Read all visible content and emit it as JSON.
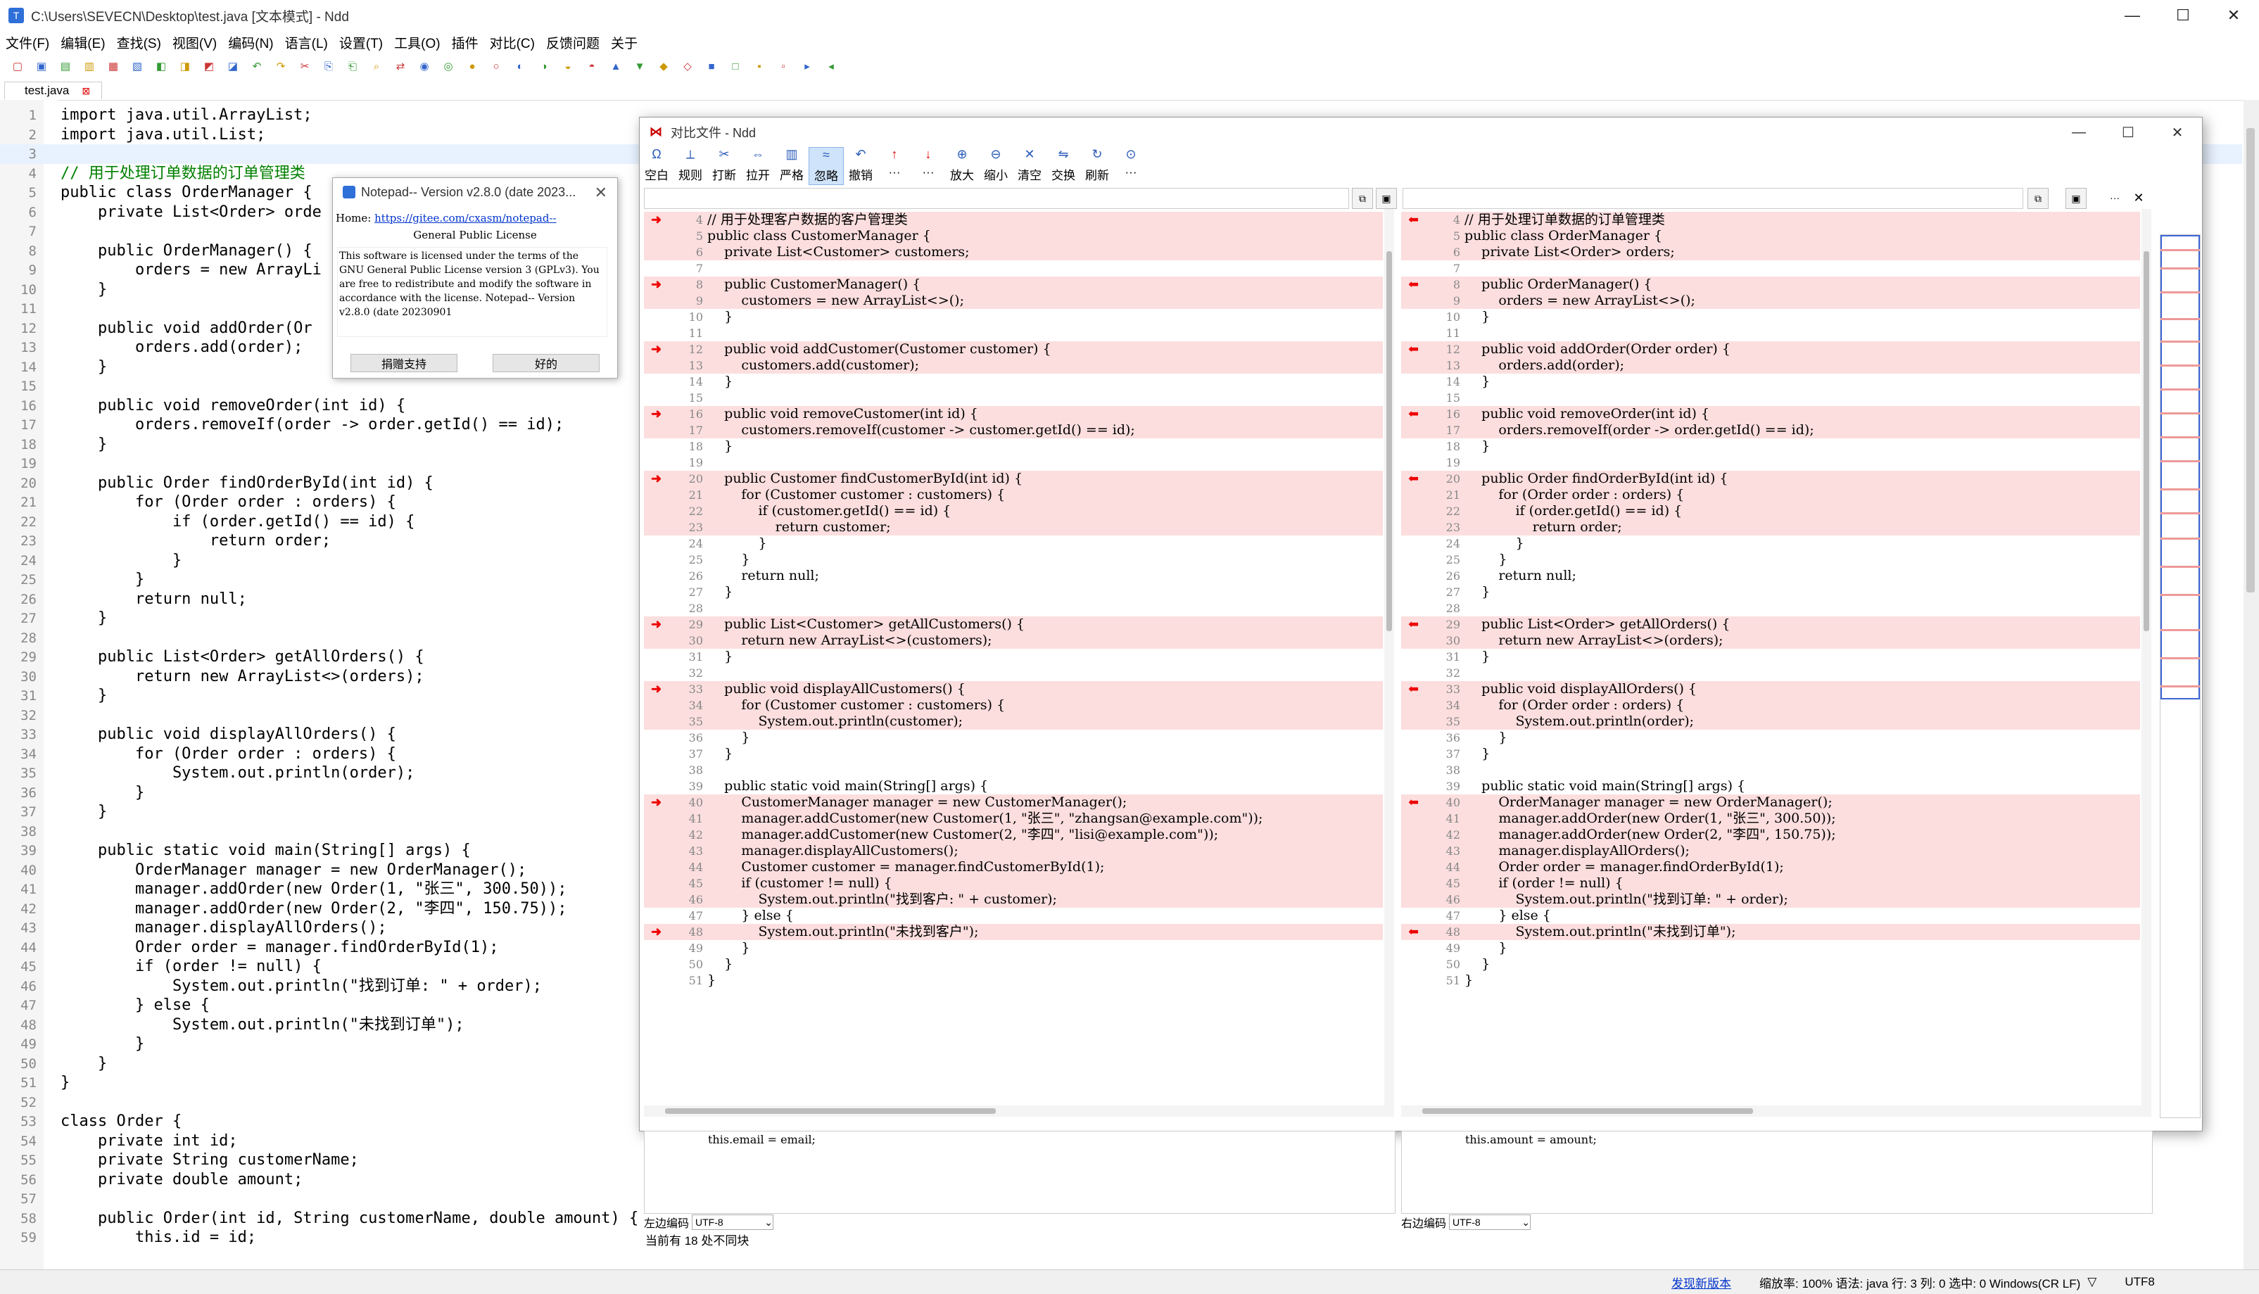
{
  "window": {
    "title": "C:\\Users\\SEVECN\\Desktop\\test.java [文本模式] - Ndd",
    "minimize": "—",
    "maximize": "☐",
    "close": "✕"
  },
  "menu": [
    "文件(F)",
    "编辑(E)",
    "查找(S)",
    "视图(V)",
    "编码(N)",
    "语言(L)",
    "设置(T)",
    "工具(O)",
    "插件",
    "对比(C)",
    "反馈问题",
    "关于"
  ],
  "tab": {
    "label": "test.java",
    "close": "⊠"
  },
  "editor_lines": [
    {
      "n": "1",
      "t": "import java.util.ArrayList;"
    },
    {
      "n": "2",
      "t": "import java.util.List;"
    },
    {
      "n": "3",
      "t": ""
    },
    {
      "n": "4",
      "t": "// 用于处理订单数据的订单管理类"
    },
    {
      "n": "5",
      "t": "public class OrderManager {"
    },
    {
      "n": "6",
      "t": "    private List<Order> orde"
    },
    {
      "n": "7",
      "t": ""
    },
    {
      "n": "8",
      "t": "    public OrderManager() {"
    },
    {
      "n": "9",
      "t": "        orders = new ArrayLi"
    },
    {
      "n": "10",
      "t": "    }"
    },
    {
      "n": "11",
      "t": ""
    },
    {
      "n": "12",
      "t": "    public void addOrder(Or"
    },
    {
      "n": "13",
      "t": "        orders.add(order);"
    },
    {
      "n": "14",
      "t": "    }"
    },
    {
      "n": "15",
      "t": ""
    },
    {
      "n": "16",
      "t": "    public void removeOrder(int id) {"
    },
    {
      "n": "17",
      "t": "        orders.removeIf(order -> order.getId() == id);"
    },
    {
      "n": "18",
      "t": "    }"
    },
    {
      "n": "19",
      "t": ""
    },
    {
      "n": "20",
      "t": "    public Order findOrderById(int id) {"
    },
    {
      "n": "21",
      "t": "        for (Order order : orders) {"
    },
    {
      "n": "22",
      "t": "            if (order.getId() == id) {"
    },
    {
      "n": "23",
      "t": "                return order;"
    },
    {
      "n": "24",
      "t": "            }"
    },
    {
      "n": "25",
      "t": "        }"
    },
    {
      "n": "26",
      "t": "        return null;"
    },
    {
      "n": "27",
      "t": "    }"
    },
    {
      "n": "28",
      "t": ""
    },
    {
      "n": "29",
      "t": "    public List<Order> getAllOrders() {"
    },
    {
      "n": "30",
      "t": "        return new ArrayList<>(orders);"
    },
    {
      "n": "31",
      "t": "    }"
    },
    {
      "n": "32",
      "t": ""
    },
    {
      "n": "33",
      "t": "    public void displayAllOrders() {"
    },
    {
      "n": "34",
      "t": "        for (Order order : orders) {"
    },
    {
      "n": "35",
      "t": "            System.out.println(order);"
    },
    {
      "n": "36",
      "t": "        }"
    },
    {
      "n": "37",
      "t": "    }"
    },
    {
      "n": "38",
      "t": ""
    },
    {
      "n": "39",
      "t": "    public static void main(String[] args) {"
    },
    {
      "n": "40",
      "t": "        OrderManager manager = new OrderManager();"
    },
    {
      "n": "41",
      "t": "        manager.addOrder(new Order(1, \"张三\", 300.50));"
    },
    {
      "n": "42",
      "t": "        manager.addOrder(new Order(2, \"李四\", 150.75));"
    },
    {
      "n": "43",
      "t": "        manager.displayAllOrders();"
    },
    {
      "n": "44",
      "t": "        Order order = manager.findOrderById(1);"
    },
    {
      "n": "45",
      "t": "        if (order != null) {"
    },
    {
      "n": "46",
      "t": "            System.out.println(\"找到订单: \" + order);"
    },
    {
      "n": "47",
      "t": "        } else {"
    },
    {
      "n": "48",
      "t": "            System.out.println(\"未找到订单\");"
    },
    {
      "n": "49",
      "t": "        }"
    },
    {
      "n": "50",
      "t": "    }"
    },
    {
      "n": "51",
      "t": "}"
    },
    {
      "n": "52",
      "t": ""
    },
    {
      "n": "53",
      "t": "class Order {"
    },
    {
      "n": "54",
      "t": "    private int id;"
    },
    {
      "n": "55",
      "t": "    private String customerName;"
    },
    {
      "n": "56",
      "t": "    private double amount;"
    },
    {
      "n": "57",
      "t": ""
    },
    {
      "n": "58",
      "t": "    public Order(int id, String customerName, double amount) {"
    },
    {
      "n": "59",
      "t": "        this.id = id;"
    }
  ],
  "about": {
    "title": "Notepad-- Version v2.8.0 (date 2023...",
    "home_label": "Home:",
    "home_url": "https://gitee.com/cxasm/notepad--",
    "gpl": "General Public License",
    "license": "This software is licensed under the terms of the GNU General Public License version 3 (GPLv3). You are free to redistribute and modify the software in accordance with the license. Notepad-- Version v2.8.0 (date 20230901",
    "donate": "捐赠支持",
    "ok": "好的"
  },
  "compare": {
    "title": "对比文件 - Ndd",
    "tools": [
      "空白",
      "规则",
      "打断",
      "拉开",
      "严格",
      "忽略",
      "撤销",
      "···",
      "···",
      "放大",
      "缩小",
      "清空",
      "交换",
      "刷新",
      "···"
    ],
    "left_detail": "this.email = email;",
    "right_detail": "this.amount = amount;",
    "left_enc_label": "左边编码",
    "right_enc_label": "右边编码",
    "enc": "UTF-8",
    "status": "当前有 18 处不同块",
    "left": [
      {
        "n": "4",
        "t": "// 用于处理客户数据的客户管理类",
        "d": true
      },
      {
        "n": "5",
        "t": "public class CustomerManager {",
        "d": true
      },
      {
        "n": "6",
        "t": "    private List<Customer> customers;",
        "d": true
      },
      {
        "n": "7",
        "t": "",
        "d": false
      },
      {
        "n": "8",
        "t": "    public CustomerManager() {",
        "d": true
      },
      {
        "n": "9",
        "t": "        customers = new ArrayList<>();",
        "d": true
      },
      {
        "n": "10",
        "t": "    }",
        "d": false
      },
      {
        "n": "11",
        "t": "",
        "d": false
      },
      {
        "n": "12",
        "t": "    public void addCustomer(Customer customer) {",
        "d": true
      },
      {
        "n": "13",
        "t": "        customers.add(customer);",
        "d": true
      },
      {
        "n": "14",
        "t": "    }",
        "d": false
      },
      {
        "n": "15",
        "t": "",
        "d": false
      },
      {
        "n": "16",
        "t": "    public void removeCustomer(int id) {",
        "d": true
      },
      {
        "n": "17",
        "t": "        customers.removeIf(customer -> customer.getId() == id);",
        "d": true
      },
      {
        "n": "18",
        "t": "    }",
        "d": false
      },
      {
        "n": "19",
        "t": "",
        "d": false
      },
      {
        "n": "20",
        "t": "    public Customer findCustomerById(int id) {",
        "d": true
      },
      {
        "n": "21",
        "t": "        for (Customer customer : customers) {",
        "d": true
      },
      {
        "n": "22",
        "t": "            if (customer.getId() == id) {",
        "d": true
      },
      {
        "n": "23",
        "t": "                return customer;",
        "d": true
      },
      {
        "n": "24",
        "t": "            }",
        "d": false
      },
      {
        "n": "25",
        "t": "        }",
        "d": false
      },
      {
        "n": "26",
        "t": "        return null;",
        "d": false
      },
      {
        "n": "27",
        "t": "    }",
        "d": false
      },
      {
        "n": "28",
        "t": "",
        "d": false
      },
      {
        "n": "29",
        "t": "    public List<Customer> getAllCustomers() {",
        "d": true
      },
      {
        "n": "30",
        "t": "        return new ArrayList<>(customers);",
        "d": true
      },
      {
        "n": "31",
        "t": "    }",
        "d": false
      },
      {
        "n": "32",
        "t": "",
        "d": false
      },
      {
        "n": "33",
        "t": "    public void displayAllCustomers() {",
        "d": true
      },
      {
        "n": "34",
        "t": "        for (Customer customer : customers) {",
        "d": true
      },
      {
        "n": "35",
        "t": "            System.out.println(customer);",
        "d": true
      },
      {
        "n": "36",
        "t": "        }",
        "d": false
      },
      {
        "n": "37",
        "t": "    }",
        "d": false
      },
      {
        "n": "38",
        "t": "",
        "d": false
      },
      {
        "n": "39",
        "t": "    public static void main(String[] args) {",
        "d": false
      },
      {
        "n": "40",
        "t": "        CustomerManager manager = new CustomerManager();",
        "d": true
      },
      {
        "n": "41",
        "t": "        manager.addCustomer(new Customer(1, \"张三\", \"zhangsan@example.com\"));",
        "d": true
      },
      {
        "n": "42",
        "t": "        manager.addCustomer(new Customer(2, \"李四\", \"lisi@example.com\"));",
        "d": true
      },
      {
        "n": "43",
        "t": "        manager.displayAllCustomers();",
        "d": true
      },
      {
        "n": "44",
        "t": "        Customer customer = manager.findCustomerById(1);",
        "d": true
      },
      {
        "n": "45",
        "t": "        if (customer != null) {",
        "d": true
      },
      {
        "n": "46",
        "t": "            System.out.println(\"找到客户: \" + customer);",
        "d": true
      },
      {
        "n": "47",
        "t": "        } else {",
        "d": false
      },
      {
        "n": "48",
        "t": "            System.out.println(\"未找到客户\");",
        "d": true
      },
      {
        "n": "49",
        "t": "        }",
        "d": false
      },
      {
        "n": "50",
        "t": "    }",
        "d": false
      },
      {
        "n": "51",
        "t": "}",
        "d": false
      }
    ],
    "right": [
      {
        "n": "4",
        "t": "// 用于处理订单数据的订单管理类",
        "d": true
      },
      {
        "n": "5",
        "t": "public class OrderManager {",
        "d": true
      },
      {
        "n": "6",
        "t": "    private List<Order> orders;",
        "d": true
      },
      {
        "n": "7",
        "t": "",
        "d": false
      },
      {
        "n": "8",
        "t": "    public OrderManager() {",
        "d": true
      },
      {
        "n": "9",
        "t": "        orders = new ArrayList<>();",
        "d": true
      },
      {
        "n": "10",
        "t": "    }",
        "d": false
      },
      {
        "n": "11",
        "t": "",
        "d": false
      },
      {
        "n": "12",
        "t": "    public void addOrder(Order order) {",
        "d": true
      },
      {
        "n": "13",
        "t": "        orders.add(order);",
        "d": true
      },
      {
        "n": "14",
        "t": "    }",
        "d": false
      },
      {
        "n": "15",
        "t": "",
        "d": false
      },
      {
        "n": "16",
        "t": "    public void removeOrder(int id) {",
        "d": true
      },
      {
        "n": "17",
        "t": "        orders.removeIf(order -> order.getId() == id);",
        "d": true
      },
      {
        "n": "18",
        "t": "    }",
        "d": false
      },
      {
        "n": "19",
        "t": "",
        "d": false
      },
      {
        "n": "20",
        "t": "    public Order findOrderById(int id) {",
        "d": true
      },
      {
        "n": "21",
        "t": "        for (Order order : orders) {",
        "d": true
      },
      {
        "n": "22",
        "t": "            if (order.getId() == id) {",
        "d": true
      },
      {
        "n": "23",
        "t": "                return order;",
        "d": true
      },
      {
        "n": "24",
        "t": "            }",
        "d": false
      },
      {
        "n": "25",
        "t": "        }",
        "d": false
      },
      {
        "n": "26",
        "t": "        return null;",
        "d": false
      },
      {
        "n": "27",
        "t": "    }",
        "d": false
      },
      {
        "n": "28",
        "t": "",
        "d": false
      },
      {
        "n": "29",
        "t": "    public List<Order> getAllOrders() {",
        "d": true
      },
      {
        "n": "30",
        "t": "        return new ArrayList<>(orders);",
        "d": true
      },
      {
        "n": "31",
        "t": "    }",
        "d": false
      },
      {
        "n": "32",
        "t": "",
        "d": false
      },
      {
        "n": "33",
        "t": "    public void displayAllOrders() {",
        "d": true
      },
      {
        "n": "34",
        "t": "        for (Order order : orders) {",
        "d": true
      },
      {
        "n": "35",
        "t": "            System.out.println(order);",
        "d": true
      },
      {
        "n": "36",
        "t": "        }",
        "d": false
      },
      {
        "n": "37",
        "t": "    }",
        "d": false
      },
      {
        "n": "38",
        "t": "",
        "d": false
      },
      {
        "n": "39",
        "t": "    public static void main(String[] args) {",
        "d": false
      },
      {
        "n": "40",
        "t": "        OrderManager manager = new OrderManager();",
        "d": true
      },
      {
        "n": "41",
        "t": "        manager.addOrder(new Order(1, \"张三\", 300.50));",
        "d": true
      },
      {
        "n": "42",
        "t": "        manager.addOrder(new Order(2, \"李四\", 150.75));",
        "d": true
      },
      {
        "n": "43",
        "t": "        manager.displayAllOrders();",
        "d": true
      },
      {
        "n": "44",
        "t": "        Order order = manager.findOrderById(1);",
        "d": true
      },
      {
        "n": "45",
        "t": "        if (order != null) {",
        "d": true
      },
      {
        "n": "46",
        "t": "            System.out.println(\"找到订单: \" + order);",
        "d": true
      },
      {
        "n": "47",
        "t": "        } else {",
        "d": false
      },
      {
        "n": "48",
        "t": "            System.out.println(\"未找到订单\");",
        "d": true
      },
      {
        "n": "49",
        "t": "        }",
        "d": false
      },
      {
        "n": "50",
        "t": "    }",
        "d": false
      },
      {
        "n": "51",
        "t": "}",
        "d": false
      }
    ]
  },
  "status": {
    "update": "发现新版本",
    "info": "缩放率: 100%  语法: java  行: 3  列: 0  选中: 0  Windows(CR LF)",
    "eol_arrow": "▽",
    "enc": "UTF8"
  }
}
